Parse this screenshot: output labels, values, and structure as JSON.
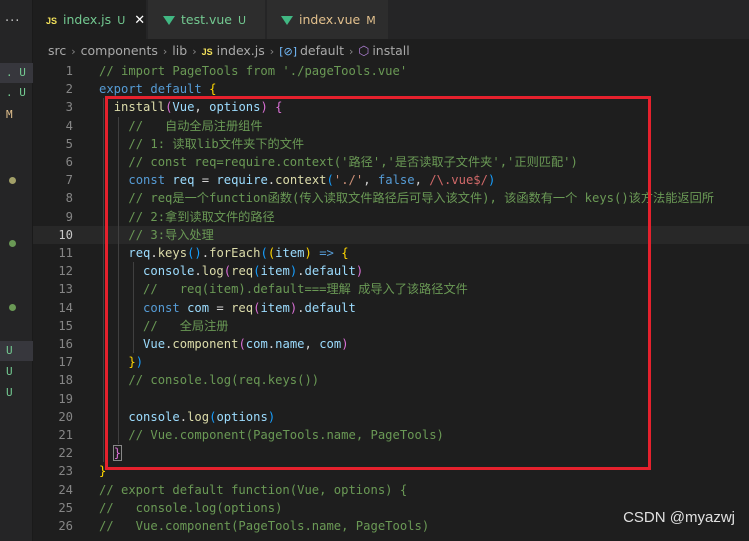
{
  "side": {
    "more": "···",
    "markers": [
      {
        "text": ". U",
        "kind": "u",
        "selected": true
      },
      {
        "text": ". U",
        "kind": "u",
        "selected": false
      },
      {
        "text": "M",
        "kind": "m",
        "selected": false
      },
      {
        "text": "U",
        "kind": "u",
        "selected": true
      },
      {
        "text": "U",
        "kind": "u",
        "selected": false
      },
      {
        "text": "U",
        "kind": "u",
        "selected": false
      }
    ],
    "dot_colors": [
      "#a2a068",
      "#6a9955",
      "#6a9955"
    ]
  },
  "tabs": [
    {
      "icon": "JS",
      "name": "index.js",
      "status": "U",
      "active": true,
      "close": "✕"
    },
    {
      "icon": "vue",
      "name": "test.vue",
      "status": "U",
      "active": false
    },
    {
      "icon": "vue",
      "name": "index.vue",
      "status": "M",
      "active": false
    }
  ],
  "breadcrumb": {
    "parts": [
      "src",
      "components",
      "lib"
    ],
    "file_icon": "JS",
    "file": "index.js",
    "export_icon": "[⊘]",
    "export": "default",
    "method_icon": "⬡",
    "method": "install"
  },
  "editor": {
    "current_line": 10,
    "lines": [
      {
        "n": "1",
        "t": [
          [
            "c",
            "// import PageTools from './pageTools.vue'"
          ]
        ]
      },
      {
        "n": "2",
        "t": [
          [
            "k",
            "export"
          ],
          [
            "p",
            " "
          ],
          [
            "k",
            "default"
          ],
          [
            "p",
            " "
          ],
          [
            "b1",
            "{"
          ]
        ]
      },
      {
        "n": "3",
        "t": [
          [
            "p",
            "  "
          ],
          [
            "f",
            "install"
          ],
          [
            "b2",
            "("
          ],
          [
            "v",
            "Vue"
          ],
          [
            "p",
            ", "
          ],
          [
            "v",
            "options"
          ],
          [
            "b2",
            ")"
          ],
          [
            "p",
            " "
          ],
          [
            "b2",
            "{"
          ]
        ]
      },
      {
        "n": "4",
        "t": [
          [
            "p",
            "    "
          ],
          [
            "c",
            "//   自动全局注册组件"
          ]
        ]
      },
      {
        "n": "5",
        "t": [
          [
            "p",
            "    "
          ],
          [
            "c",
            "// 1: 读取lib文件夹下的文件"
          ]
        ]
      },
      {
        "n": "6",
        "t": [
          [
            "p",
            "    "
          ],
          [
            "c",
            "// const req=require.context('路径','是否读取子文件夹','正则匹配')"
          ]
        ]
      },
      {
        "n": "7",
        "t": [
          [
            "p",
            "    "
          ],
          [
            "k",
            "const"
          ],
          [
            "p",
            " "
          ],
          [
            "v",
            "req"
          ],
          [
            "p",
            " = "
          ],
          [
            "v",
            "require"
          ],
          [
            "p",
            "."
          ],
          [
            "f",
            "context"
          ],
          [
            "b3",
            "("
          ],
          [
            "s",
            "'./'"
          ],
          [
            "p",
            ", "
          ],
          [
            "k",
            "false"
          ],
          [
            "p",
            ", "
          ],
          [
            "r",
            "/\\.vue$/"
          ],
          [
            "b3",
            ")"
          ]
        ]
      },
      {
        "n": "8",
        "t": [
          [
            "p",
            "    "
          ],
          [
            "c",
            "// req是一个function函数(传入读取文件路径后可导入该文件), 该函数有一个 keys()该方法能返回所"
          ]
        ]
      },
      {
        "n": "9",
        "t": [
          [
            "p",
            "    "
          ],
          [
            "c",
            "// 2:拿到读取文件的路径"
          ]
        ]
      },
      {
        "n": "10",
        "t": [
          [
            "p",
            "    "
          ],
          [
            "c",
            "// 3:导入处理"
          ]
        ]
      },
      {
        "n": "11",
        "t": [
          [
            "p",
            "    "
          ],
          [
            "v",
            "req"
          ],
          [
            "p",
            "."
          ],
          [
            "f",
            "keys"
          ],
          [
            "b3",
            "()"
          ],
          [
            "p",
            "."
          ],
          [
            "f",
            "forEach"
          ],
          [
            "b3",
            "("
          ],
          [
            "b1",
            "("
          ],
          [
            "v",
            "item"
          ],
          [
            "b1",
            ")"
          ],
          [
            "p",
            " "
          ],
          [
            "k",
            "=>"
          ],
          [
            "p",
            " "
          ],
          [
            "b1",
            "{"
          ]
        ]
      },
      {
        "n": "12",
        "t": [
          [
            "p",
            "      "
          ],
          [
            "v",
            "console"
          ],
          [
            "p",
            "."
          ],
          [
            "f",
            "log"
          ],
          [
            "b2",
            "("
          ],
          [
            "f",
            "req"
          ],
          [
            "b3",
            "("
          ],
          [
            "v",
            "item"
          ],
          [
            "b3",
            ")"
          ],
          [
            "p",
            "."
          ],
          [
            "v",
            "default"
          ],
          [
            "b2",
            ")"
          ]
        ]
      },
      {
        "n": "13",
        "t": [
          [
            "p",
            "      "
          ],
          [
            "c",
            "//   req(item).default===理解 成导入了该路径文件"
          ]
        ]
      },
      {
        "n": "14",
        "t": [
          [
            "p",
            "      "
          ],
          [
            "k",
            "const"
          ],
          [
            "p",
            " "
          ],
          [
            "v",
            "com"
          ],
          [
            "p",
            " = "
          ],
          [
            "f",
            "req"
          ],
          [
            "b2",
            "("
          ],
          [
            "v",
            "item"
          ],
          [
            "b2",
            ")"
          ],
          [
            "p",
            "."
          ],
          [
            "v",
            "default"
          ]
        ]
      },
      {
        "n": "15",
        "t": [
          [
            "p",
            "      "
          ],
          [
            "c",
            "//   全局注册"
          ]
        ]
      },
      {
        "n": "16",
        "t": [
          [
            "p",
            "      "
          ],
          [
            "v",
            "Vue"
          ],
          [
            "p",
            "."
          ],
          [
            "f",
            "component"
          ],
          [
            "b2",
            "("
          ],
          [
            "v",
            "com"
          ],
          [
            "p",
            "."
          ],
          [
            "v",
            "name"
          ],
          [
            "p",
            ", "
          ],
          [
            "v",
            "com"
          ],
          [
            "b2",
            ")"
          ]
        ]
      },
      {
        "n": "17",
        "t": [
          [
            "p",
            "    "
          ],
          [
            "b1",
            "}"
          ],
          [
            "b3",
            ")"
          ]
        ]
      },
      {
        "n": "18",
        "t": [
          [
            "p",
            "    "
          ],
          [
            "c",
            "// console.log(req.keys())"
          ]
        ]
      },
      {
        "n": "19",
        "t": []
      },
      {
        "n": "20",
        "t": [
          [
            "p",
            "    "
          ],
          [
            "v",
            "console"
          ],
          [
            "p",
            "."
          ],
          [
            "f",
            "log"
          ],
          [
            "b3",
            "("
          ],
          [
            "v",
            "options"
          ],
          [
            "b3",
            ")"
          ]
        ]
      },
      {
        "n": "21",
        "t": [
          [
            "p",
            "    "
          ],
          [
            "c",
            "// Vue.component(PageTools.name, PageTools)"
          ]
        ]
      },
      {
        "n": "22",
        "t": [
          [
            "p",
            "  "
          ],
          [
            "b2 bm",
            "}"
          ]
        ]
      },
      {
        "n": "23",
        "t": [
          [
            "b1",
            "}"
          ]
        ]
      },
      {
        "n": "24",
        "t": [
          [
            "c",
            "// export default function(Vue, options) {"
          ]
        ]
      },
      {
        "n": "25",
        "t": [
          [
            "c",
            "//   console.log(options)"
          ]
        ]
      },
      {
        "n": "26",
        "t": [
          [
            "c",
            "//   Vue.component(PageTools.name, PageTools)"
          ]
        ]
      }
    ]
  },
  "watermark": "CSDN @myazwj"
}
